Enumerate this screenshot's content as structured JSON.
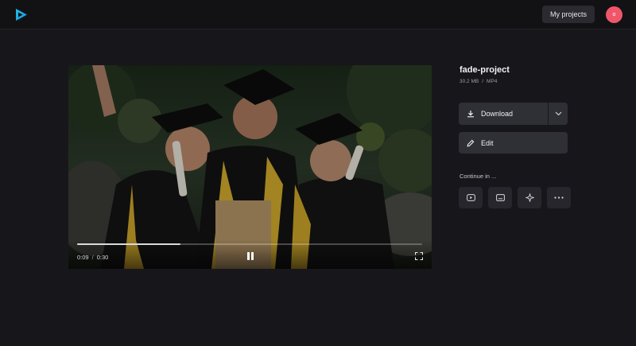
{
  "header": {
    "logo_icon": "play-triangle-logo",
    "my_projects_label": "My projects",
    "avatar_initial": "o",
    "avatar_color": "#f0566a"
  },
  "player": {
    "current_time": "0:09",
    "separator": "/",
    "duration": "0:30",
    "progress": 0.3,
    "state": "playing",
    "pause_icon": "pause-icon",
    "fullscreen_icon": "fullscreen-icon"
  },
  "project": {
    "title": "fade-project",
    "size": "30.2 MB",
    "meta_separator": "/",
    "format": "MP4"
  },
  "actions": {
    "download_label": "Download",
    "edit_label": "Edit"
  },
  "continue": {
    "label": "Continue in ...",
    "options": [
      "youtube-icon",
      "subtitles-icon",
      "sparkle-icon",
      "more-icon"
    ]
  },
  "colors": {
    "accent_logo_start": "#19c3e6",
    "accent_logo_end": "#1f8fe0",
    "background": "#17171b"
  }
}
